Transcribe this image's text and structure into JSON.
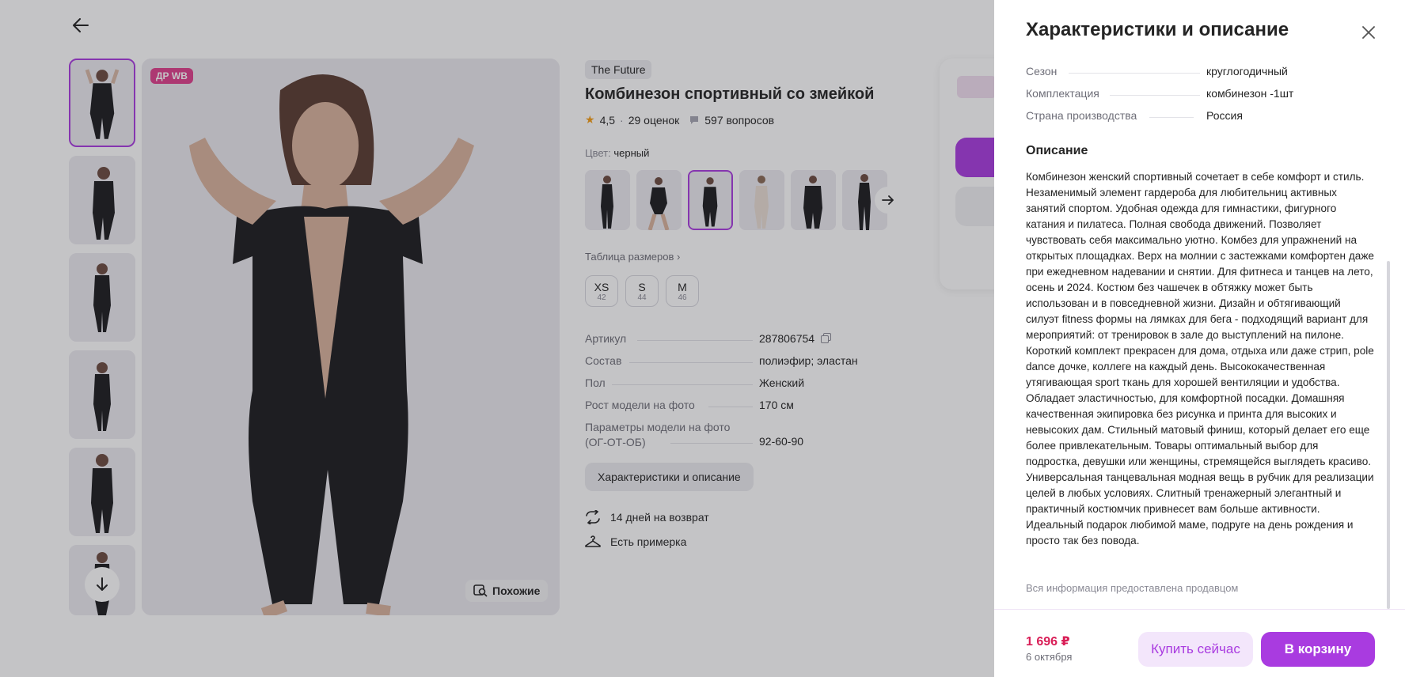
{
  "product": {
    "badge": "ДР WB",
    "brand": "The Future",
    "title": "Комбинезон спортивный со змейкой",
    "rating": "4,5",
    "ratings_count": "29 оценок",
    "questions": "597 вопросов",
    "color_label": "Цвет:",
    "color_value": "черный",
    "size_table": "Таблица размеров",
    "sizes": [
      {
        "name": "XS",
        "ru": "42"
      },
      {
        "name": "S",
        "ru": "44"
      },
      {
        "name": "M",
        "ru": "46"
      }
    ],
    "specs": [
      {
        "k": "Артикул",
        "v": "287806754"
      },
      {
        "k": "Состав",
        "v": "полиэфир; эластан"
      },
      {
        "k": "Пол",
        "v": "Женский"
      },
      {
        "k": "Рост модели на фото",
        "v": "170 см"
      },
      {
        "k": "Параметры модели на фото (ОГ-ОТ-ОБ)",
        "v": "92-60-90"
      }
    ],
    "char_button": "Характеристики и описание",
    "features": [
      "14 дней на возврат",
      "Есть примерка"
    ],
    "similar": "Похожие"
  },
  "icons": [
    "back-arrow-icon",
    "star-icon",
    "questions-icon",
    "copy-icon",
    "chevron-right-icon",
    "return-icon",
    "hanger-icon",
    "search-similar-icon",
    "arrow-down-icon",
    "close-icon"
  ],
  "panel": {
    "title": "Характеристики и описание",
    "chars": [
      {
        "k": "Сезон",
        "v": "круглогодичный"
      },
      {
        "k": "Комплектация",
        "v": "комбинезон -1шт"
      },
      {
        "k": "Страна производства",
        "v": "Россия"
      }
    ],
    "desc_title": "Описание",
    "description": "Комбинезон женский спортивный сочетает в себе комфорт и стиль. Незаменимый элемент гардероба для любительниц активных занятий спортом. Удобная одежда для гимнастики, фигурного катания и пилатеса. Полная свобода движений. Позволяет чувствовать себя максимально уютно. Комбез для упражнений на открытых площадках. Верх на молнии с застежками комфортен даже при ежедневном надевании и снятии. Для фитнеса и танцев на лето, осень и 2024. Костюм без чашечек в обтяжку может быть использован и в повседневной жизни. Дизайн и обтягивающий силуэт fitness формы на лямках для бега - подходящий вариант для мероприятий: от тренировок в зале до выступлений на пилоне. Короткий комплект прекрасен для дома, отдыха или даже стрип, pole dance дочке, коллеге на каждый день. Высококачественная утягивающая sport ткань для хорошей вентиляции и удобства. Обладает эластичностью, для комфортной посадки. Домашняя качественная экипировка без рисунка и принта для высоких и невысоких дам. Стильный матовый финиш, который делает его еще более привлекательным. Товары оптимальный выбор для подростка, девушки или женщины, стремящейся выглядеть красиво. Универсальная танцевальная модная вещь в рубчик для реализации целей в любых условиях. Слитный тренажерный элегантный и практичный костюмчик привнесет вам больше активности. Идеальный подарок любимой маме, подруге на день рождения и просто так без повода.",
    "seller_note": "Вся информация предоставлена продавцом",
    "price": "1 696 ₽",
    "delivery": "6 октября",
    "buy_now": "Купить сейчас",
    "to_cart": "В корзину"
  },
  "colors": {
    "accent": "#a93be0",
    "price": "#d91e57",
    "badge": "#e0408c"
  }
}
